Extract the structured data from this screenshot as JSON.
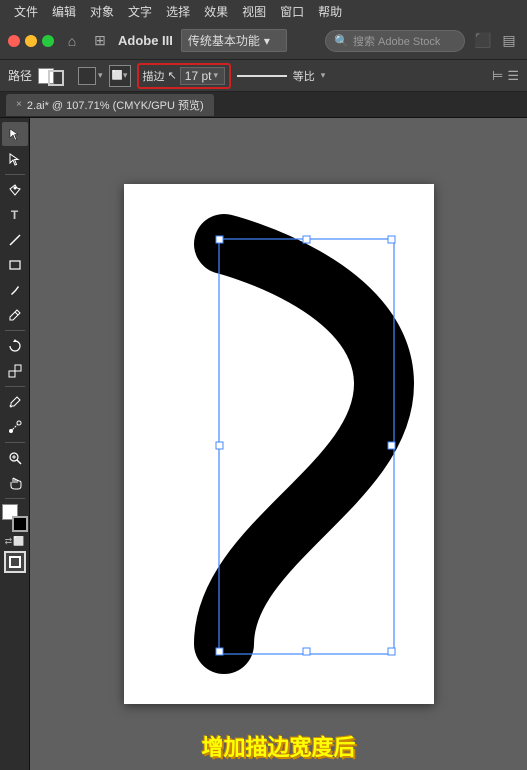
{
  "menubar": {
    "items": [
      "文件",
      "编辑",
      "对象",
      "文字",
      "选择",
      "效果",
      "视图",
      "窗口",
      "帮助"
    ]
  },
  "titlebar": {
    "app_name": "Adobe III",
    "workspace": "传统基本功能",
    "search_placeholder": "搜索 Adobe Stock"
  },
  "controlbar": {
    "path_label": "路径",
    "stroke_label": "描边",
    "stroke_width": "17 pt",
    "ratio_label": "等比"
  },
  "tab": {
    "close": "×",
    "name": "2.ai* @ 107.71% (CMYK/GPU 预览)"
  },
  "tools": {
    "list": [
      "▶",
      "↖",
      "✏",
      "✒",
      "T",
      "✂",
      "⬜",
      "◯",
      "✎",
      "🔍",
      "🤚"
    ]
  },
  "caption": {
    "text": "增加描边宽度后"
  }
}
